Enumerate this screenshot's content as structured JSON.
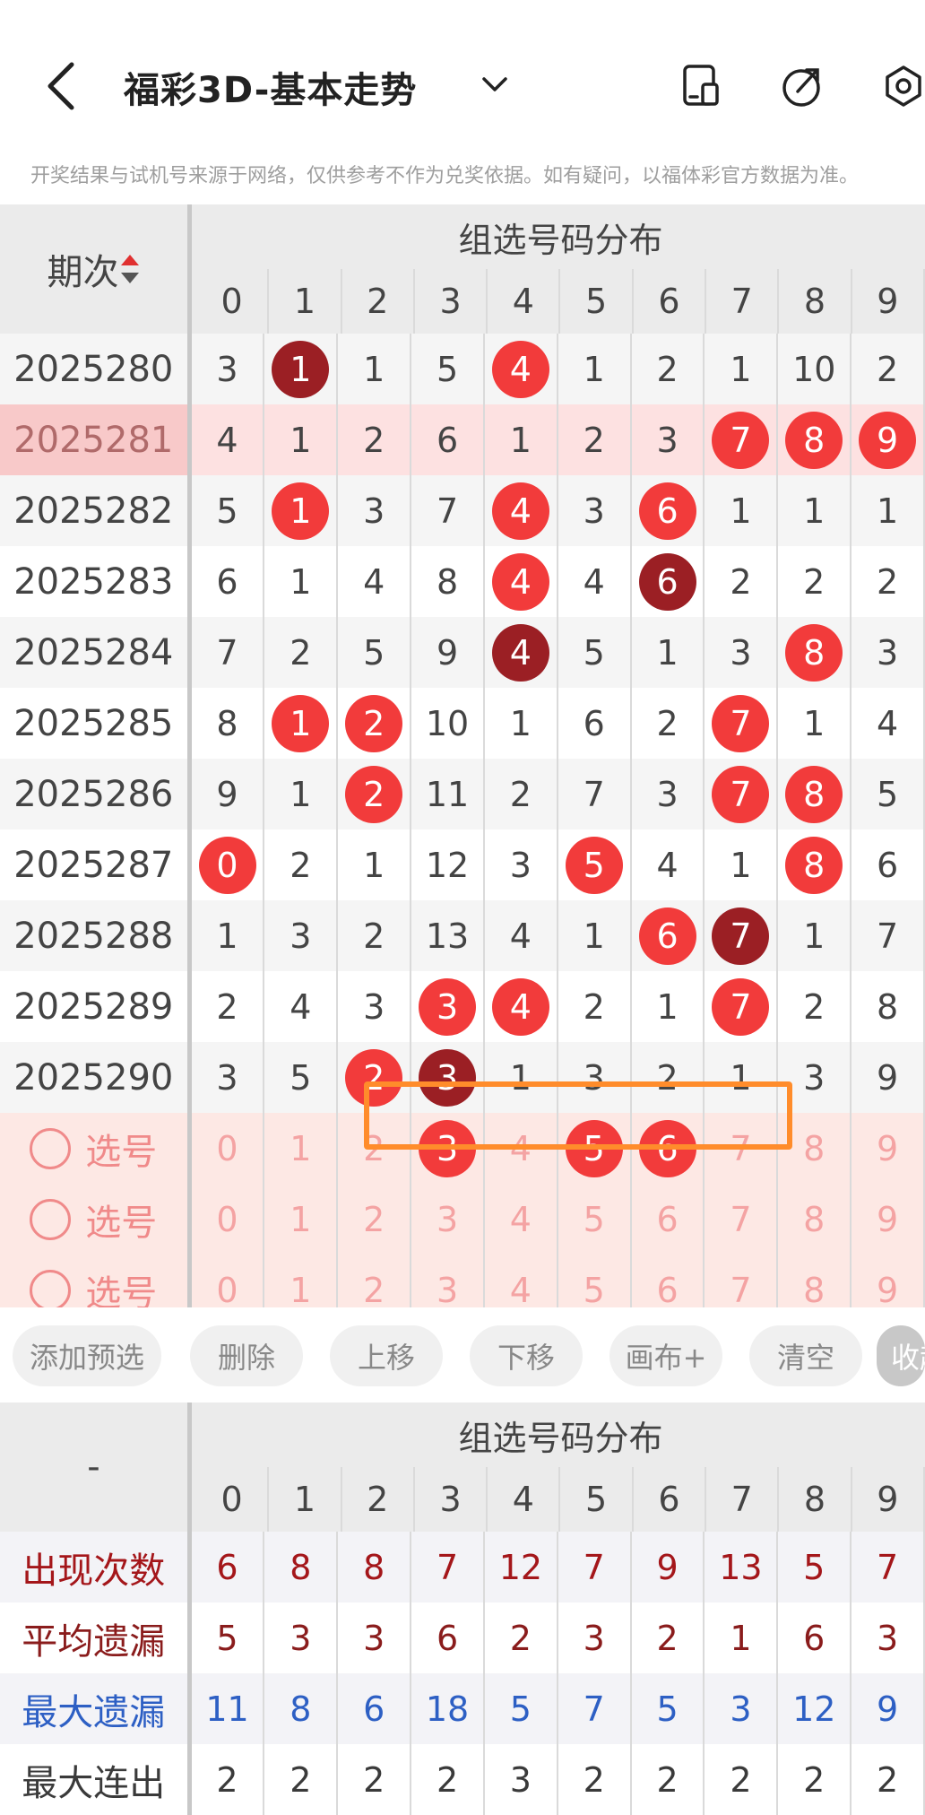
{
  "header": {
    "title": "福彩3D-基本走势",
    "icons": [
      "back-icon",
      "dropdown-caret-icon",
      "phone-icon",
      "share-icon",
      "settings-icon"
    ]
  },
  "notice": "开奖结果与试机号来源于网络，仅供参考不作为兑奖依据。如有疑问，以福体彩官方数据为准。",
  "table": {
    "period_label": "期次",
    "section_title": "组选号码分布",
    "columns": [
      "0",
      "1",
      "2",
      "3",
      "4",
      "5",
      "6",
      "7",
      "8",
      "9"
    ],
    "rows": [
      {
        "period": "2025280",
        "cells": [
          "3",
          "1",
          "1",
          "5",
          "4",
          "1",
          "2",
          "1",
          "10",
          "2"
        ],
        "balls": {
          "1": "dark",
          "4": "red"
        }
      },
      {
        "period": "2025281",
        "cells": [
          "4",
          "1",
          "2",
          "6",
          "1",
          "2",
          "3",
          "7",
          "8",
          "9"
        ],
        "balls": {
          "7": "red",
          "8": "red",
          "9": "red"
        },
        "highlight": true
      },
      {
        "period": "2025282",
        "cells": [
          "5",
          "1",
          "3",
          "7",
          "4",
          "3",
          "6",
          "1",
          "1",
          "1"
        ],
        "balls": {
          "1": "red",
          "4": "red",
          "6": "red"
        }
      },
      {
        "period": "2025283",
        "cells": [
          "6",
          "1",
          "4",
          "8",
          "4",
          "4",
          "6",
          "2",
          "2",
          "2"
        ],
        "balls": {
          "4": "red",
          "6": "dark"
        }
      },
      {
        "period": "2025284",
        "cells": [
          "7",
          "2",
          "5",
          "9",
          "4",
          "5",
          "1",
          "3",
          "8",
          "3"
        ],
        "balls": {
          "4": "dark",
          "8": "red"
        }
      },
      {
        "period": "2025285",
        "cells": [
          "8",
          "1",
          "2",
          "10",
          "1",
          "6",
          "2",
          "7",
          "1",
          "4"
        ],
        "balls": {
          "1": "red",
          "2": "red",
          "7": "red"
        }
      },
      {
        "period": "2025286",
        "cells": [
          "9",
          "1",
          "2",
          "11",
          "2",
          "7",
          "3",
          "7",
          "8",
          "5"
        ],
        "balls": {
          "2": "red",
          "7": "red",
          "8": "red"
        }
      },
      {
        "period": "2025287",
        "cells": [
          "0",
          "2",
          "1",
          "12",
          "3",
          "5",
          "4",
          "1",
          "8",
          "6"
        ],
        "balls": {
          "0": "red",
          "5": "red",
          "8": "red"
        }
      },
      {
        "period": "2025288",
        "cells": [
          "1",
          "3",
          "2",
          "13",
          "4",
          "1",
          "6",
          "7",
          "1",
          "7"
        ],
        "balls": {
          "6": "red",
          "7": "dark"
        }
      },
      {
        "period": "2025289",
        "cells": [
          "2",
          "4",
          "3",
          "3",
          "4",
          "2",
          "1",
          "7",
          "2",
          "8"
        ],
        "balls": {
          "3": "red",
          "4": "red",
          "7": "red"
        }
      },
      {
        "period": "2025290",
        "cells": [
          "3",
          "5",
          "2",
          "3",
          "1",
          "3",
          "2",
          "1",
          "3",
          "9"
        ],
        "balls": {
          "2": "red",
          "3": "dark"
        }
      }
    ],
    "select_rows": [
      {
        "label": "选号",
        "cells": [
          "0",
          "1",
          "2",
          "3",
          "4",
          "5",
          "6",
          "7",
          "8",
          "9"
        ],
        "balls": {
          "3": "red",
          "5": "red",
          "6": "red"
        }
      },
      {
        "label": "选号",
        "cells": [
          "0",
          "1",
          "2",
          "3",
          "4",
          "5",
          "6",
          "7",
          "8",
          "9"
        ],
        "balls": {}
      },
      {
        "label": "选号",
        "cells": [
          "0",
          "1",
          "2",
          "3",
          "4",
          "5",
          "6",
          "7",
          "8",
          "9"
        ],
        "balls": {}
      }
    ]
  },
  "toolbar": {
    "buttons": [
      "添加预选",
      "删除",
      "上移",
      "下移",
      "画布+",
      "清空",
      "收起"
    ]
  },
  "stats": {
    "corner": "-",
    "section_title": "组选号码分布",
    "columns": [
      "0",
      "1",
      "2",
      "3",
      "4",
      "5",
      "6",
      "7",
      "8",
      "9"
    ],
    "rows": [
      {
        "label": "出现次数",
        "values": [
          "6",
          "8",
          "8",
          "7",
          "12",
          "7",
          "9",
          "13",
          "5",
          "7"
        ],
        "color": "#a4161a"
      },
      {
        "label": "平均遗漏",
        "values": [
          "5",
          "3",
          "3",
          "6",
          "2",
          "3",
          "2",
          "1",
          "6",
          "3"
        ],
        "color": "#8a1c1c"
      },
      {
        "label": "最大遗漏",
        "values": [
          "11",
          "8",
          "6",
          "18",
          "5",
          "7",
          "5",
          "3",
          "12",
          "9"
        ],
        "color": "#2d5fc4"
      },
      {
        "label": "最大连出",
        "values": [
          "2",
          "2",
          "2",
          "2",
          "3",
          "2",
          "2",
          "2",
          "2",
          "2"
        ],
        "color": "#3a3a3a"
      }
    ]
  },
  "colors": {
    "ball_red": "#f23b3b",
    "ball_dark": "#9b1f24",
    "highlight_box": "#ff8c2b"
  }
}
